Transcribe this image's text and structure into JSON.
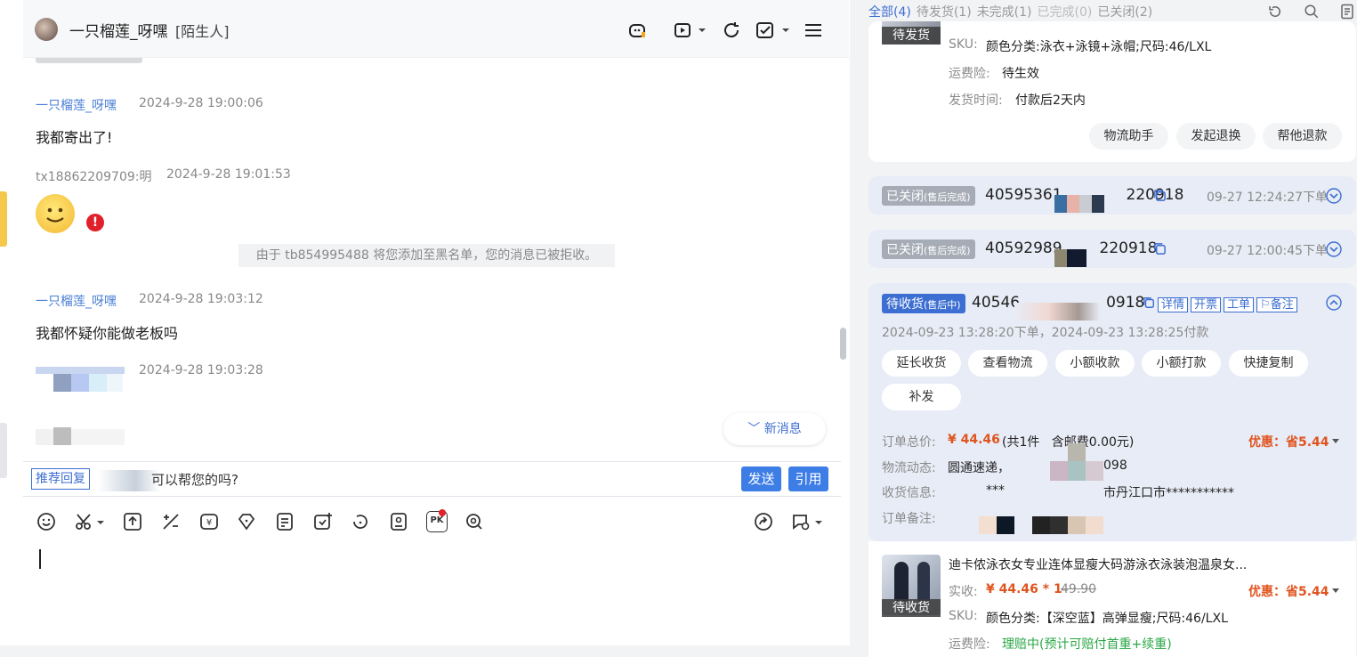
{
  "chat": {
    "contact_name": "一只榴莲_呀嘿",
    "contact_tag": "[陌生人]",
    "messages": [
      {
        "sender": "一只榴莲_呀嘿",
        "time": "2024-9-28 19:00:06",
        "text": "我都寄出了!"
      },
      {
        "sender": "tx18862209709:明",
        "time": "2024-9-28 19:01:53",
        "text": ""
      },
      {
        "sender": "一只榴莲_呀嘿",
        "time": "2024-9-28 19:03:12",
        "text": "我都怀疑你能做老板吗"
      },
      {
        "sender": "",
        "time": "2024-9-28 19:03:28",
        "text": ""
      }
    ],
    "system_note": "由于 tb854995488 将您添加至黑名单，您的消息已被拒收。",
    "error_mark": "!",
    "new_message_label": "﹀ 新消息",
    "suggest_tag": "推荐回复",
    "suggest_text": "可以帮您的吗?",
    "send_label": "发送",
    "quote_label": "引用",
    "pk_label": "PK"
  },
  "orders": {
    "tabs": [
      "全部(4)",
      "待发货(1)",
      "未完成(1)",
      "已完成(0)",
      "已关闭(2)"
    ],
    "top_card": {
      "status": "待发货",
      "sku_label": "SKU:",
      "sku": "颜色分类:泳衣+泳镜+泳帽;尺码:46/LXL",
      "insurance_label": "运费险:",
      "insurance": "待生效",
      "ship_label": "发货时间:",
      "ship": "付款后2天内",
      "actions": [
        "物流助手",
        "发起退换",
        "帮他退款"
      ]
    },
    "closed_1": {
      "status": "已关闭",
      "sub": "(售后完成)",
      "order_a": "40595361",
      "order_b": "220918",
      "time": "09-27 12:24:27下单"
    },
    "closed_2": {
      "status": "已关闭",
      "sub": "(售后完成)",
      "order_a": "40592989",
      "order_b": "220918",
      "time": "09-27 12:00:45下单"
    },
    "active": {
      "status": "待收货",
      "sub": "(售后中)",
      "order_a": "40546",
      "order_b": "0918",
      "tags": [
        "详情",
        "开票",
        "工单",
        "备注"
      ],
      "dates": "2024-09-23 13:28:20下单，2024-09-23 13:28:25付款",
      "actions": [
        "延长收货",
        "查看物流",
        "小额收款",
        "小额打款",
        "快捷复制",
        "补发"
      ],
      "total_label": "订单总价:",
      "total": "¥ 44.46",
      "total_detail": "(共1件   含邮费0.00元)",
      "discount": "优惠：省5.44",
      "logistics_label": "物流动态:",
      "logistics": "圆通速递，",
      "logistics_tail": "098",
      "address_label": "收货信息:",
      "address_a": "***",
      "address_b": "市丹江口市***********",
      "remark_label": "订单备注:"
    },
    "product": {
      "title": "迪卡侬泳衣女专业连体显瘦大码游泳衣泳装泡温泉女...",
      "status": "待收货",
      "paid_label": "实收:",
      "paid": "¥ 44.46 * 1",
      "orig_price": "49.90",
      "discount": "优惠：省5.44",
      "sku_label": "SKU:",
      "sku": "颜色分类:【深空蓝】高弹显瘦;尺码:46/LXL",
      "insurance_label": "运费险:",
      "insurance": "理赔中(预计可赔付首重+续重)"
    }
  }
}
